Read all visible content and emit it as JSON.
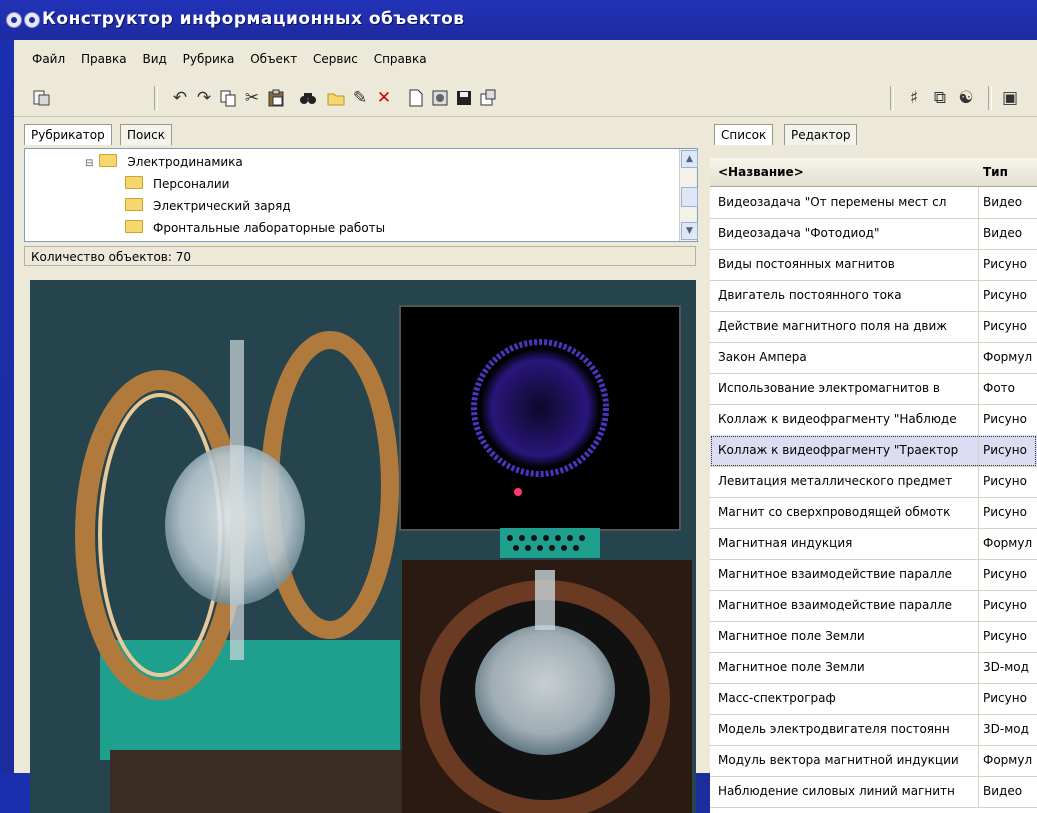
{
  "window": {
    "title": "Конструктор информационных объектов"
  },
  "menu": [
    "Файл",
    "Правка",
    "Вид",
    "Рубрика",
    "Объект",
    "Сервис",
    "Справка"
  ],
  "toolbar": {
    "icons": [
      "database-icon",
      "undo-icon",
      "redo-icon",
      "copy-icon",
      "cut-icon",
      "paste-icon",
      "find-icon",
      "open-icon",
      "edit-icon",
      "delete-icon",
      "new-doc-icon",
      "settings-icon",
      "save-icon",
      "properties-icon",
      "tool-a-icon",
      "tool-b-icon",
      "tool-c-icon"
    ]
  },
  "left_tabs": [
    "Рубрикатор",
    "Поиск"
  ],
  "tree": {
    "root": "Электродинамика",
    "children": [
      "Персоналии",
      "Электрический заряд",
      "Фронтальные лабораторные работы"
    ]
  },
  "status": "Количество объектов: 70",
  "right_tabs": [
    "Список",
    "Редактор"
  ],
  "grid": {
    "headers": [
      "<Название>",
      "Тип"
    ],
    "rows": [
      {
        "name": "Видеозадача \"От перемены мест сл",
        "type": "Видео"
      },
      {
        "name": "Видеозадача \"Фотодиод\"",
        "type": "Видео"
      },
      {
        "name": "Виды постоянных магнитов",
        "type": "Рисуно"
      },
      {
        "name": "Двигатель постоянного тока",
        "type": "Рисуно"
      },
      {
        "name": "Действие магнитного поля на движ",
        "type": "Рисуно"
      },
      {
        "name": "Закон Ампера",
        "type": "Формул"
      },
      {
        "name": "Использование электромагнитов в",
        "type": "Фото"
      },
      {
        "name": "Коллаж к видеофрагменту \"Наблюде",
        "type": "Рисуно"
      },
      {
        "name": "Коллаж к видеофрагменту \"Траектор",
        "type": "Рисуно",
        "selected": true
      },
      {
        "name": "Левитация металлического предмет",
        "type": "Рисуно"
      },
      {
        "name": "Магнит со сверхпроводящей обмотк",
        "type": "Рисуно"
      },
      {
        "name": "Магнитная индукция",
        "type": "Формул"
      },
      {
        "name": "Магнитное взаимодействие паралле",
        "type": "Рисуно"
      },
      {
        "name": "Магнитное взаимодействие паралле",
        "type": "Рисуно"
      },
      {
        "name": "Магнитное поле Земли",
        "type": "Рисуно"
      },
      {
        "name": "Магнитное поле Земли",
        "type": "3D-мод"
      },
      {
        "name": "Масс-спектрограф",
        "type": "Рисуно"
      },
      {
        "name": "Модель электродвигателя постоянн",
        "type": "3D-мод"
      },
      {
        "name": "Модуль вектора магнитной индукции",
        "type": "Формул"
      },
      {
        "name": "Наблюдение силовых линий магнитн",
        "type": "Видео"
      }
    ]
  }
}
